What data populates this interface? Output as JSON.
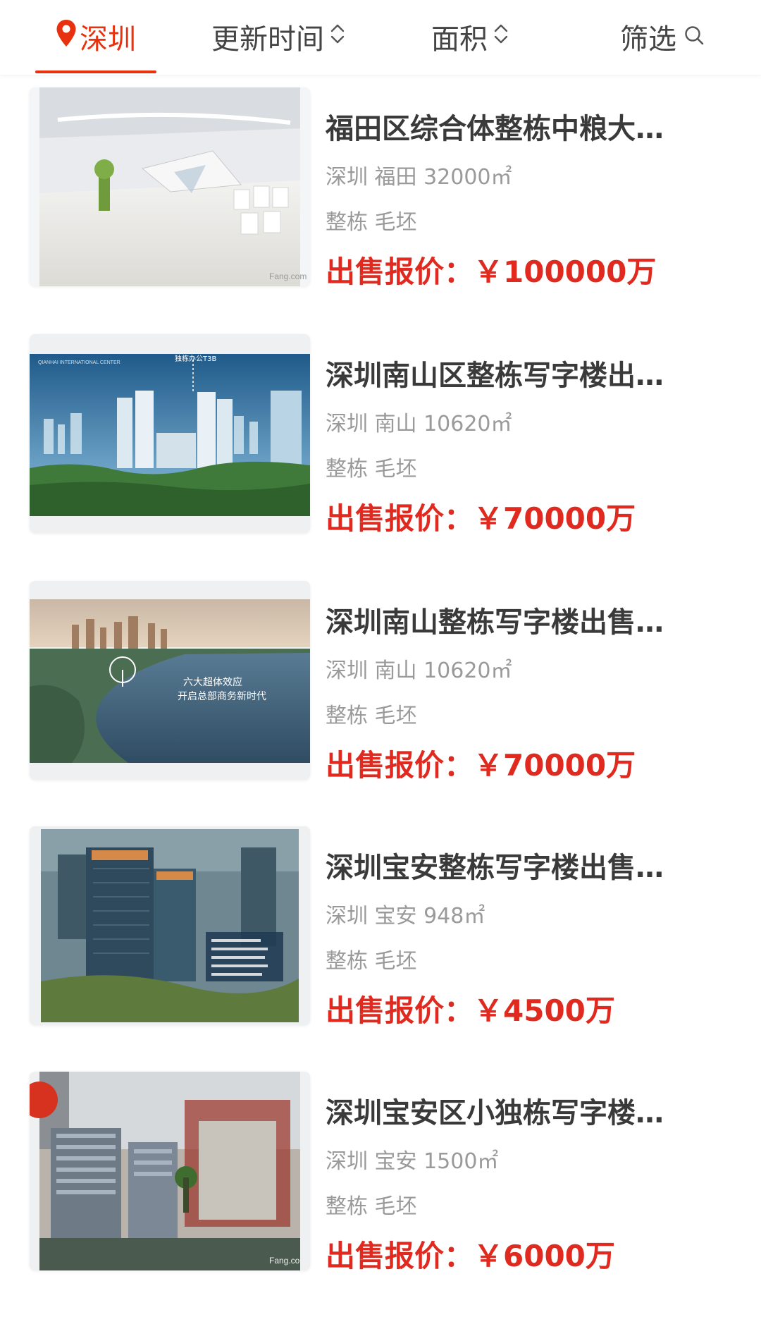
{
  "filters": {
    "city": "深圳",
    "update_time": "更新时间",
    "area": "面积",
    "screen": "筛选"
  },
  "listings": [
    {
      "title": "福田区综合体整栋中粮大…",
      "location": "深圳 福田 32000㎡",
      "type": "整栋 毛坯",
      "price": "出售报价：￥100000万",
      "watermark": "Fang.com"
    },
    {
      "title": "深圳南山区整栋写字楼出…",
      "location": "深圳 南山 10620㎡",
      "type": "整栋 毛坯",
      "price": "出售报价：￥70000万",
      "image_caption": "独栋办公T3B",
      "image_label": "QIANHAI INTERNATIONAL CENTER"
    },
    {
      "title": "深圳南山整栋写字楼出售…",
      "location": "深圳 南山 10620㎡",
      "type": "整栋 毛坯",
      "price": "出售报价：￥70000万",
      "image_caption_1": "六大超体效应",
      "image_caption_2": "开启总部商务新时代"
    },
    {
      "title": "深圳宝安整栋写字楼出售…",
      "location": "深圳 宝安 948㎡",
      "type": "整栋 毛坯",
      "price": "出售报价：￥4500万"
    },
    {
      "title": "深圳宝安区小独栋写字楼…",
      "location": "深圳 宝安 1500㎡",
      "type": "整栋 毛坯",
      "price": "出售报价：￥6000万",
      "watermark": "Fang.com"
    }
  ],
  "colors": {
    "accent": "#e8320f",
    "price": "#e12a1f",
    "title": "#3a3a3a",
    "meta": "#9a9a9a"
  },
  "icons": [
    "location-pin-icon",
    "sort-updown-icon",
    "search-icon"
  ]
}
